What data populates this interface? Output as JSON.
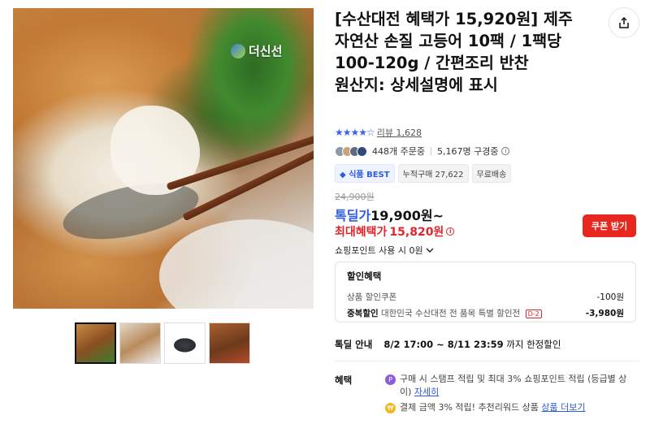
{
  "product": {
    "title": "[수산대전 혜택가 15,920원] 제주 자연산 손질 고등어 10팩 / 1팩당 100-120g / 간편조리 반찬\n원산지: 상세설명에 표시",
    "brand_logo_text": "더신선",
    "rating_stars": "★★★★☆",
    "review_label": "리뷰",
    "review_count": "1,628",
    "orders_text": "448개 주문중",
    "subscribers_text": "5,167명 구경중",
    "badges": [
      "식품 BEST",
      "누적구매 27,622",
      "무료배송"
    ],
    "original_price": "24,900원",
    "deal_price_label": "톡딜가",
    "deal_price": "19,900원~",
    "max_benefit_label": "최대혜택가",
    "max_benefit_price": "15,820원",
    "coupon_button": "쿠폰 받기",
    "points_text": "쇼핑포인트 사용 시 0원"
  },
  "discount": {
    "heading": "할인혜택",
    "rows": [
      {
        "label": "상품 할인쿠폰",
        "amount": "-100원"
      },
      {
        "label_strong": "중복할인",
        "label": "대한민국 수산대전 전 품목 특별 할인전",
        "tag": "D-2",
        "amount": "-3,980원"
      }
    ]
  },
  "deal_info": {
    "label": "톡딜 안내",
    "value": "8/2 17:00 ~ 8/11 23:59",
    "suffix": "까지 한정할인"
  },
  "benefits": {
    "label": "혜택",
    "items": [
      {
        "icon": "P",
        "text": "구매 시 스탬프 적립 및 최대 3% 쇼핑포인트 적립 (등급별 상이)",
        "link": "자세히"
      },
      {
        "icon": "₩",
        "text": "결제 금액 3% 적립! 추천리워드 상품",
        "link": "상품 더보기"
      }
    ]
  },
  "colors": {
    "accent_blue": "#2d5be3",
    "sale_red": "#e0262b",
    "coupon_red": "#e8281f"
  }
}
